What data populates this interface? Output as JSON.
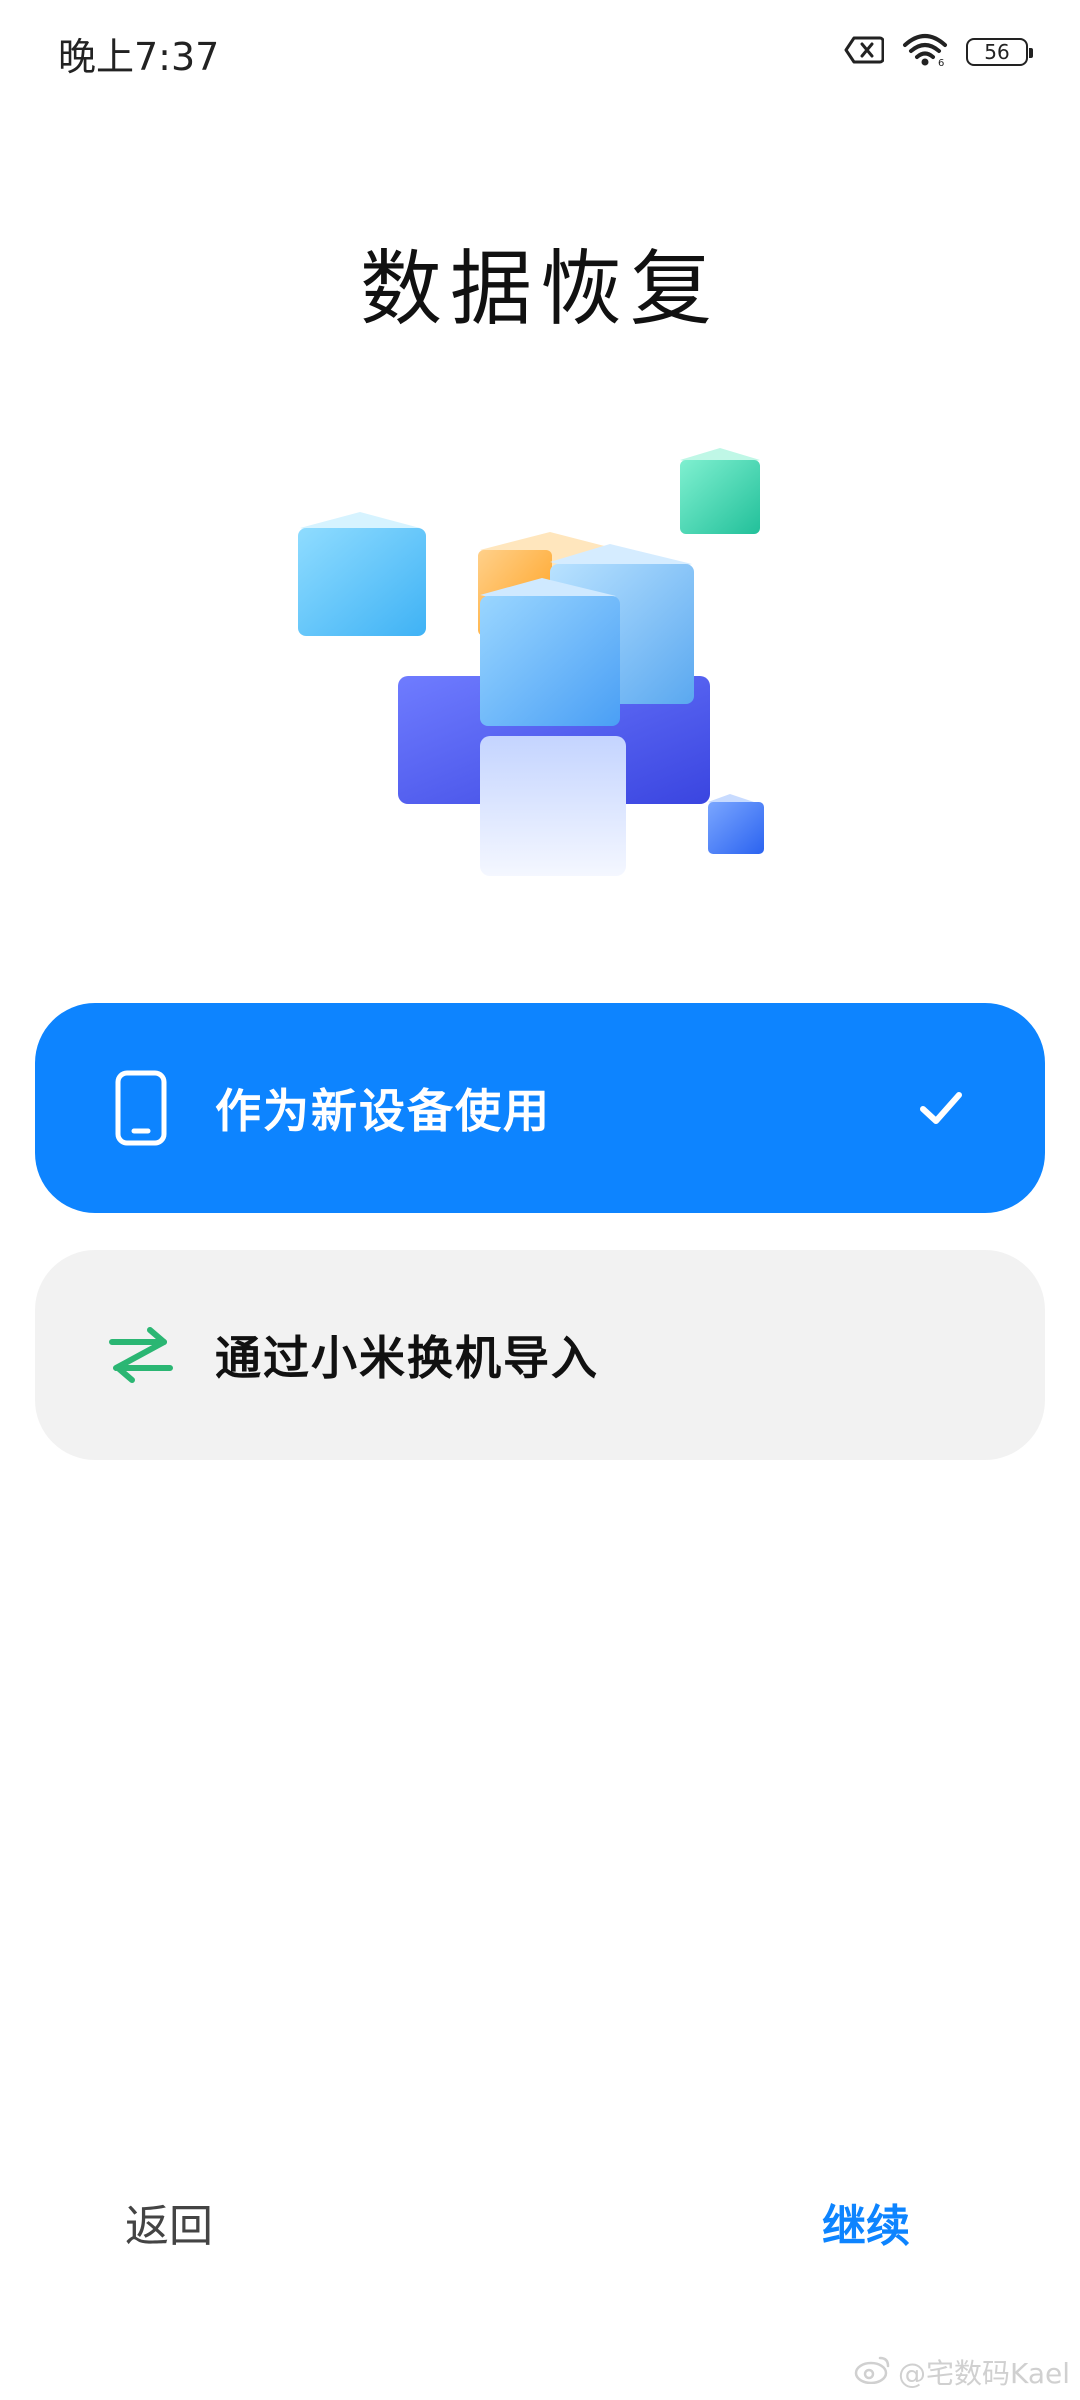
{
  "status_bar": {
    "time": "晚上7:37",
    "battery_level": "56",
    "icons": [
      "sim-error-icon",
      "wifi-icon",
      "battery-icon"
    ]
  },
  "page": {
    "title": "数据恢复"
  },
  "options": [
    {
      "label": "作为新设备使用",
      "icon": "phone-icon",
      "selected": true
    },
    {
      "label": "通过小米换机导入",
      "icon": "transfer-arrows-icon",
      "selected": false
    }
  ],
  "footer": {
    "back_label": "返回",
    "continue_label": "继续"
  },
  "watermark": {
    "text": "@宅数码Kael"
  },
  "colors": {
    "accent": "#0d84ff",
    "card_bg": "#f2f2f2",
    "transfer_icon": "#2bb673"
  }
}
